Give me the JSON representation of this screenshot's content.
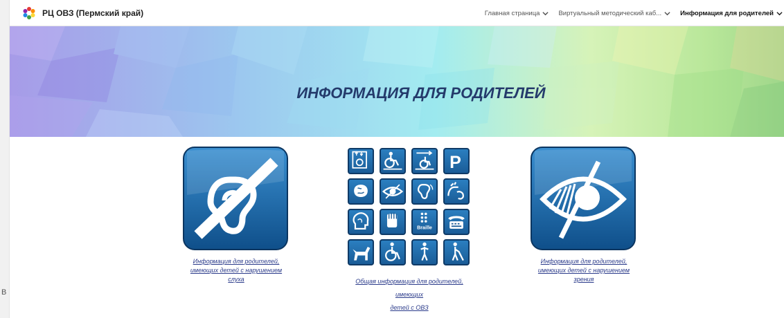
{
  "site": {
    "title": "РЦ ОВЗ (Пермский край)"
  },
  "nav": {
    "items": [
      {
        "label": "Главная страница"
      },
      {
        "label": "Виртуальный методический каб..."
      },
      {
        "label": "Информация для родителей"
      }
    ]
  },
  "banner": {
    "title": "ИНФОРМАЦИЯ ДЛЯ РОДИТЕЛЕЙ"
  },
  "cards": {
    "hearing": {
      "line1": "Информация для родителей,",
      "line2": "имеющих детей с нарушением",
      "line3": "слуха"
    },
    "general": {
      "line1": "Общая информация для родителей, имеющих",
      "line2": "детей с ОВЗ"
    },
    "vision": {
      "line1": "Информация для родителей,",
      "line2": "имеющих детей с нарушением",
      "line3": "зрения"
    }
  },
  "icons": {
    "braille_label": "Braille"
  },
  "left_edge_text": "В",
  "colors": {
    "banner_title": "#243a6b",
    "icon_blue": "#1f6aa8",
    "link": "#2a3a8a"
  }
}
